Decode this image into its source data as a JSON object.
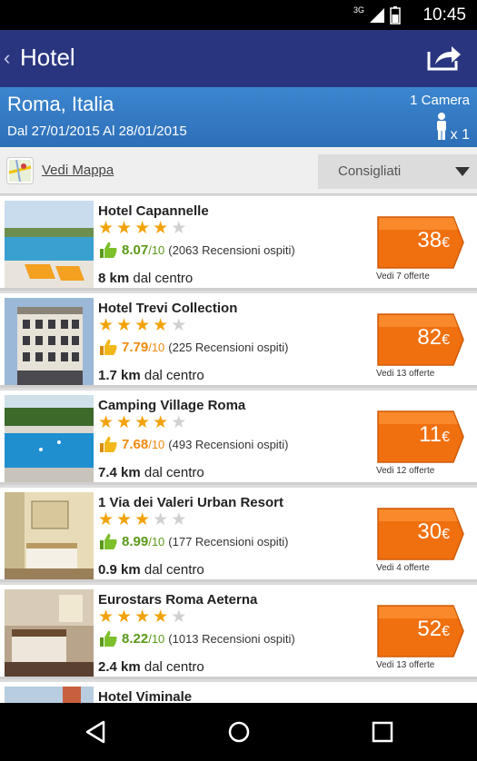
{
  "status": {
    "network": "3G",
    "time": "10:45"
  },
  "appbar": {
    "title": "Hotel",
    "back_icon": "chevron-left-icon",
    "share_icon": "share-icon"
  },
  "search": {
    "city": "Roma, Italia",
    "dates": "Dal 27/01/2015 Al 28/01/2015",
    "rooms": "1 Camera",
    "guests": "x 1"
  },
  "filter": {
    "map_label": "Vedi Mappa",
    "sort_label": "Consigliati"
  },
  "colors": {
    "appbar": "#2a3580",
    "price": "#f07010",
    "score_green": "#5a9a1a",
    "score_orange": "#f08a10",
    "star": "#f2a20a"
  },
  "hotels": [
    {
      "name": "Hotel Capannelle",
      "stars": 4,
      "score": "8.07",
      "scale": "/10",
      "reviews": "(2063 Recensioni ospiti)",
      "dist_value": "8 km",
      "dist_label": "dal centro",
      "price": "38",
      "currency": "€",
      "offers": "Vedi 7 offerte",
      "score_color": "green"
    },
    {
      "name": "Hotel Trevi Collection",
      "stars": 4,
      "score": "7.79",
      "scale": "/10",
      "reviews": "(225 Recensioni ospiti)",
      "dist_value": "1.7 km",
      "dist_label": "dal centro",
      "price": "82",
      "currency": "€",
      "offers": "Vedi 13 offerte",
      "score_color": "orange"
    },
    {
      "name": "Camping Village Roma",
      "stars": 4,
      "score": "7.68",
      "scale": "/10",
      "reviews": "(493 Recensioni ospiti)",
      "dist_value": "7.4 km",
      "dist_label": "dal centro",
      "price": "11",
      "currency": "€",
      "offers": "Vedi 12 offerte",
      "score_color": "orange"
    },
    {
      "name": "1 Via dei Valeri Urban Resort",
      "stars": 3,
      "score": "8.99",
      "scale": "/10",
      "reviews": "(177 Recensioni ospiti)",
      "dist_value": "0.9 km",
      "dist_label": "dal centro",
      "price": "30",
      "currency": "€",
      "offers": "Vedi 4 offerte",
      "score_color": "green"
    },
    {
      "name": "Eurostars Roma Aeterna",
      "stars": 4,
      "score": "8.22",
      "scale": "/10",
      "reviews": "(1013 Recensioni ospiti)",
      "dist_value": "2.4 km",
      "dist_label": "dal centro",
      "price": "52",
      "currency": "€",
      "offers": "Vedi 13 offerte",
      "score_color": "green"
    },
    {
      "name": "Hotel Viminale",
      "stars": 0,
      "score": "",
      "scale": "",
      "reviews": "",
      "dist_value": "",
      "dist_label": "",
      "price": "",
      "currency": "",
      "offers": "",
      "score_color": "green"
    }
  ],
  "navbar": {
    "back": "nav-back-icon",
    "home": "nav-home-icon",
    "recents": "nav-recents-icon"
  }
}
